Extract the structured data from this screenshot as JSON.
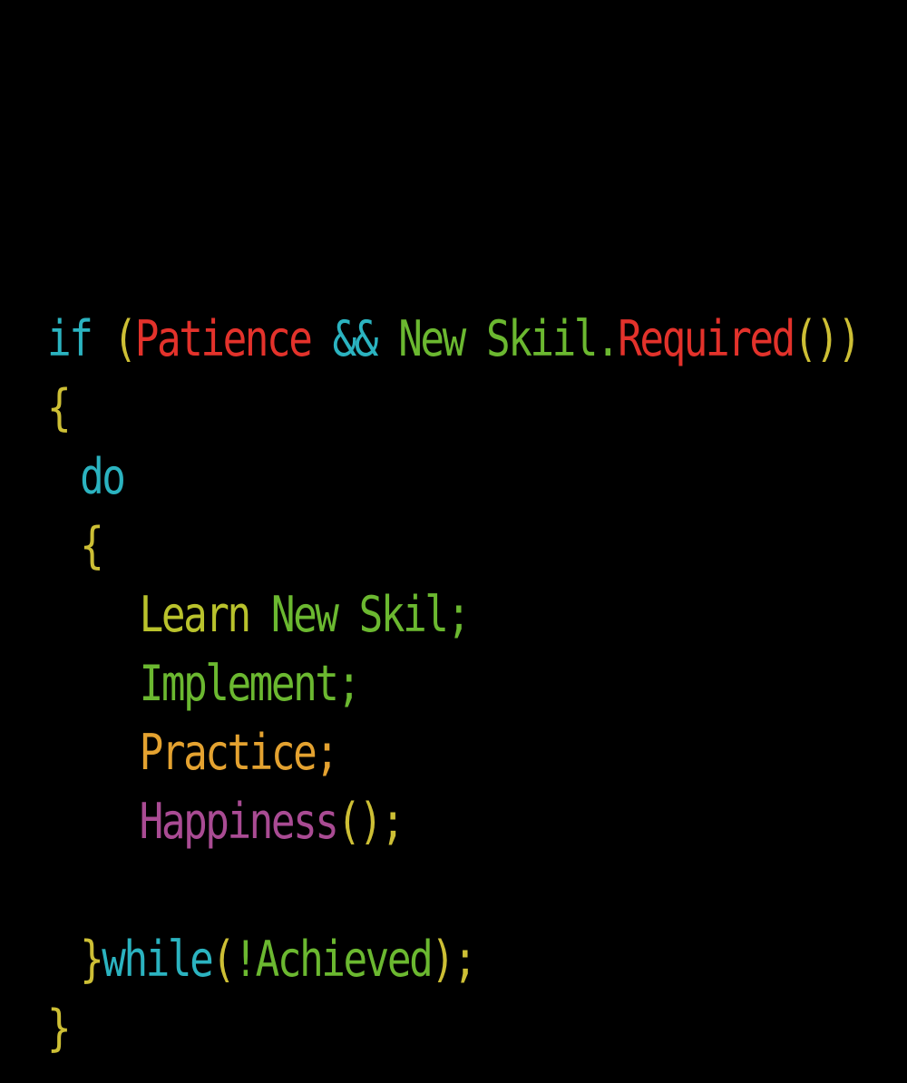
{
  "colors": {
    "background": "#000000",
    "teal": "#2bb3c0",
    "yellow": "#cdbf35",
    "red": "#e3322b",
    "green": "#6bb830",
    "olive": "#b9c22c",
    "orange": "#e4a230",
    "magenta": "#a94b93"
  },
  "code": {
    "line1": {
      "kw_if": "if ",
      "paren_open": "(",
      "patience": "Patience ",
      "and_op": "&& ",
      "new_skiil": "New Skiil.",
      "required": "Required",
      "parens_close": "())"
    },
    "line2": {
      "brace_open": "{"
    },
    "line3": {
      "kw_do": "do"
    },
    "line4": {
      "brace_open": "{"
    },
    "line5": {
      "learn": "Learn ",
      "new_skil": "New Skil;"
    },
    "line6": {
      "implement": "Implement;"
    },
    "line7": {
      "practice": "Practice;"
    },
    "line8": {
      "happiness": "Happiness",
      "call": "();"
    },
    "line10": {
      "brace_close": "}",
      "kw_while": "while",
      "paren_open": "(",
      "achieved": "!Achieved",
      "paren_close": ");"
    },
    "line11": {
      "brace_close": "}"
    }
  }
}
